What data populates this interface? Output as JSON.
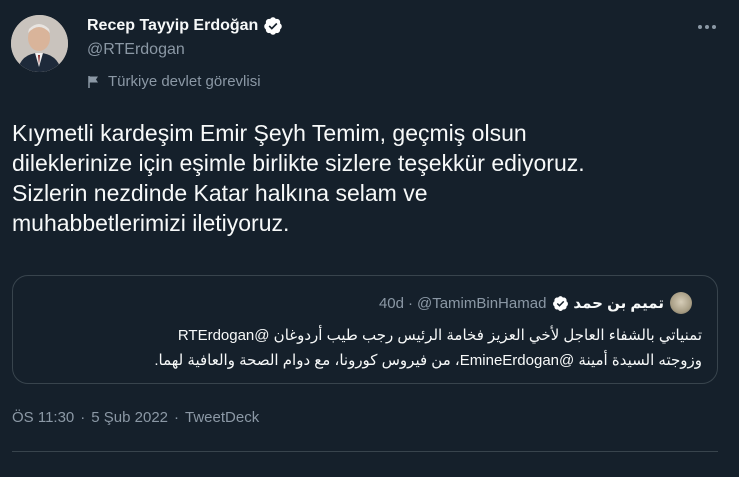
{
  "author": {
    "display_name": "Recep Tayyip Erdoğan",
    "handle": "@RTErdogan",
    "label": "Türkiye devlet görevlisi",
    "avatar_icon": "profile-photo",
    "verified_icon": "verified-badge-icon"
  },
  "tweet": {
    "text_lines": [
      "Kıymetli kardeşim Emir Şeyh Temim, geçmiş olsun",
      "dileklerinize için eşimle birlikte sizlere teşekkür ediyoruz.",
      "Sizlerin nezdinde Katar halkına selam ve",
      "muhabbetlerimizi iletiyoruz."
    ]
  },
  "quote": {
    "display_name": "تميم بن حمد",
    "handle": "@TamimBinHamad",
    "dot": "·",
    "time": "40d",
    "line1": "تمنياتي بالشفاء العاجل لأخي العزيز فخامة الرئيس رجب طيب أردوغان @RTErdogan",
    "line2": "وزوجته السيدة أمينة @EmineErdogan، من فيروس كورونا، مع دوام الصحة والعافية لهما."
  },
  "meta": {
    "time": "ÖS 11:30",
    "sep": "·",
    "date": "5 Şub 2022",
    "source": "TweetDeck"
  },
  "colors": {
    "background": "#15202b",
    "text": "#f7f9f9",
    "secondary": "#8b98a5",
    "border": "#38444d",
    "verified": "#ffffff"
  }
}
